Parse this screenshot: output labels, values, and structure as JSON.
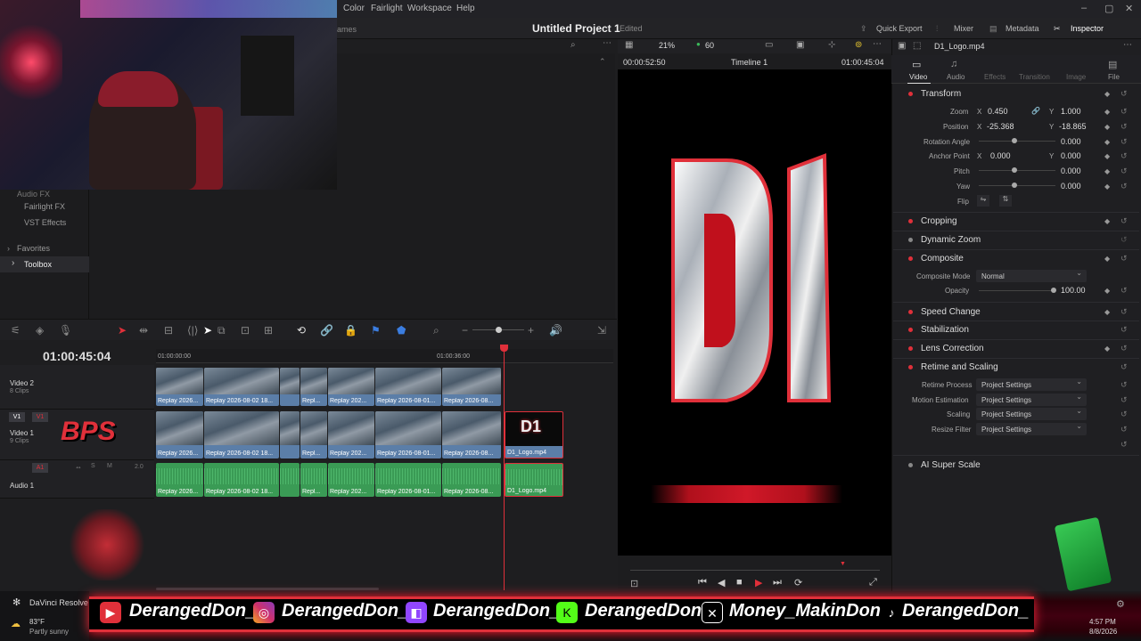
{
  "menubar": {
    "items": [
      "Color",
      "Fairlight",
      "Workspace",
      "Help"
    ]
  },
  "header": {
    "project_title": "Untitled Project 1",
    "edited": "Edited",
    "buttons": {
      "quick_export": "Quick Export",
      "mixer": "Mixer",
      "metadata": "Metadata",
      "inspector": "Inspector"
    },
    "partial_label": "ames"
  },
  "left_panel": {
    "items": [
      "Audio FX",
      "Fairlight FX",
      "VST Effects",
      "Favorites",
      "Toolbox"
    ]
  },
  "timeline": {
    "timecode": "01:00:45:04",
    "ruler": [
      "01:00:00:00",
      "01:00:36:00"
    ],
    "tracks": {
      "video2": {
        "name": "Video 2",
        "clips": "8 Clips"
      },
      "video1": {
        "name": "Video 1",
        "clips": "9 Clips",
        "v1a": "V1",
        "v1b": "V1"
      },
      "audio1": {
        "name": "Audio 1",
        "a1": "A1",
        "s": "S",
        "m": "M",
        "level": "2.0"
      }
    },
    "video2_clips": [
      "Replay 2026...",
      "Replay 2026-08-02 18...",
      "",
      "Repl...",
      "Replay 202...",
      "Replay 2026-08-01...",
      "Replay 2026-08..."
    ],
    "video1_clips": [
      "Replay 2026...",
      "Replay 2026-08-02 18...",
      "",
      "Repl...",
      "Replay 202...",
      "Replay 2026-08-01...",
      "Replay 2026-08...",
      "D1_Logo.mp4"
    ],
    "audio1_clips": [
      "Replay 2026...",
      "Replay 2026-08-02 18...",
      "",
      "Repl...",
      "Replay 202...",
      "Replay 2026-08-01...",
      "Replay 2026-08...",
      "D1_Logo.mp4"
    ]
  },
  "viewer": {
    "zoom": "21%",
    "fps": "60",
    "tc_left": "00:00:52:50",
    "timeline_name": "Timeline 1",
    "tc_right": "01:00:45:04",
    "overlay_text": "D1"
  },
  "inspector": {
    "clip_name": "D1_Logo.mp4",
    "tabs": [
      "Video",
      "Audio",
      "Effects",
      "Transition",
      "Image",
      "File"
    ],
    "transform": {
      "title": "Transform",
      "zoom_label": "Zoom",
      "zoom_x": "0.450",
      "zoom_y": "1.000",
      "position_label": "Position",
      "pos_x": "-25.368",
      "pos_y": "-18.865",
      "rotation_label": "Rotation Angle",
      "rotation": "0.000",
      "anchor_label": "Anchor Point",
      "anchor_x": "0.000",
      "anchor_y": "0.000",
      "pitch_label": "Pitch",
      "pitch": "0.000",
      "yaw_label": "Yaw",
      "yaw": "0.000",
      "flip_label": "Flip",
      "x": "X",
      "y": "Y"
    },
    "sections": {
      "cropping": "Cropping",
      "dynamic_zoom": "Dynamic Zoom",
      "composite": "Composite",
      "composite_mode_label": "Composite Mode",
      "composite_mode": "Normal",
      "opacity_label": "Opacity",
      "opacity": "100.00",
      "speed_change": "Speed Change",
      "stabilization": "Stabilization",
      "lens_correction": "Lens Correction",
      "retime": "Retime and Scaling",
      "retime_process_label": "Retime Process",
      "motion_estimation_label": "Motion Estimation",
      "scaling_label": "Scaling",
      "resize_filter_label": "Resize Filter",
      "project_settings": "Project Settings",
      "ai_super_scale": "AI Super Scale"
    }
  },
  "banner": {
    "handles": [
      "DerangedDon_",
      "DerangedDon_",
      "DerangedDon_",
      "DerangedDon",
      "Money_MakinDon",
      "DerangedDon_"
    ],
    "overlay_left": "BPS",
    "app_name": "DaVinci Resolve"
  },
  "taskbar": {
    "temp": "83°F",
    "weather": "Partly sunny",
    "time": "4:57 PM",
    "date": "8/8/2026"
  },
  "colors": {
    "accent": "#e0303a",
    "video_clip": "#5b7ea8",
    "audio_clip": "#3a9b55"
  }
}
